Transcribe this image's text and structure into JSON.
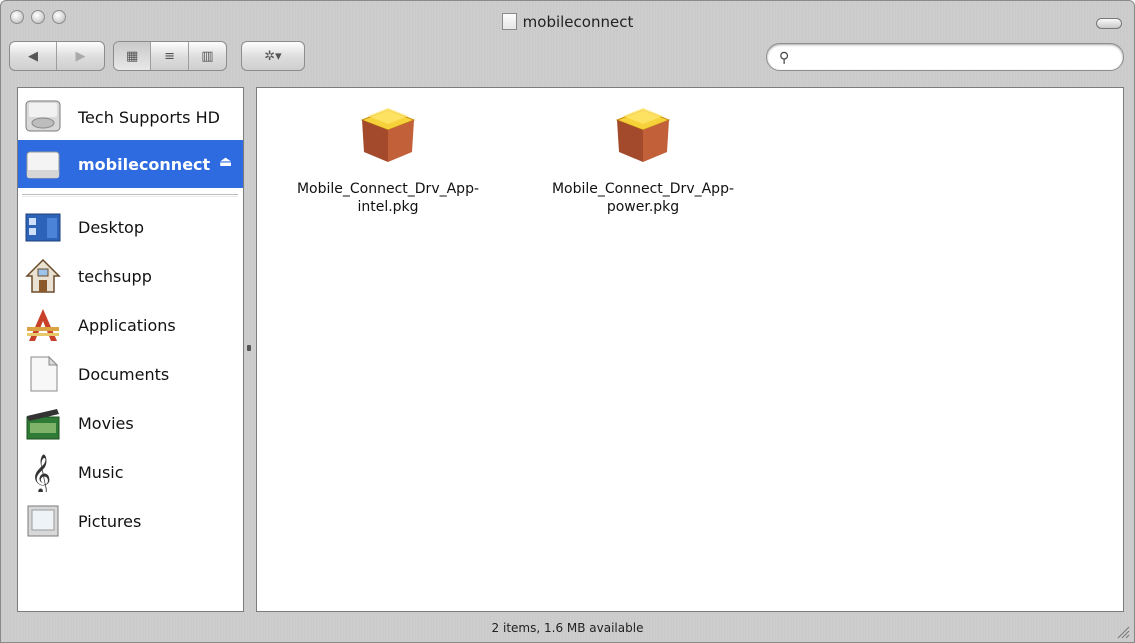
{
  "window": {
    "title": "mobileconnect",
    "buttons": [
      "close-button",
      "minimize-button",
      "zoom-button"
    ]
  },
  "toolbar": {
    "back_label": "◀",
    "forward_label": "▶",
    "view_icon": "▦",
    "view_list": "≡",
    "view_columns": "▥",
    "action_label": "✲▾",
    "search": {
      "value": "",
      "placeholder": ""
    }
  },
  "sidebar": {
    "devices": [
      {
        "label": "Tech Supports HD",
        "icon": "hard-drive-icon",
        "selected": false
      },
      {
        "label": "mobileconnect",
        "icon": "disk-image-icon",
        "selected": true,
        "eject": "⏏"
      }
    ],
    "places": [
      {
        "label": "Desktop",
        "icon": "desktop-icon"
      },
      {
        "label": "techsupp",
        "icon": "home-icon"
      },
      {
        "label": "Applications",
        "icon": "applications-icon"
      },
      {
        "label": "Documents",
        "icon": "documents-icon"
      },
      {
        "label": "Movies",
        "icon": "movies-icon"
      },
      {
        "label": "Music",
        "icon": "music-icon"
      },
      {
        "label": "Pictures",
        "icon": "pictures-icon"
      }
    ]
  },
  "files": [
    {
      "name": "Mobile_Connect_Drv_App-\nintel.pkg",
      "icon": "package-icon"
    },
    {
      "name": "Mobile_Connect_Drv_App-\npower.pkg",
      "icon": "package-icon"
    }
  ],
  "status": {
    "text": "2 items, 1.6 MB available"
  },
  "colors": {
    "selection": "#2f6be0",
    "chrome": "#c9c9c9"
  }
}
